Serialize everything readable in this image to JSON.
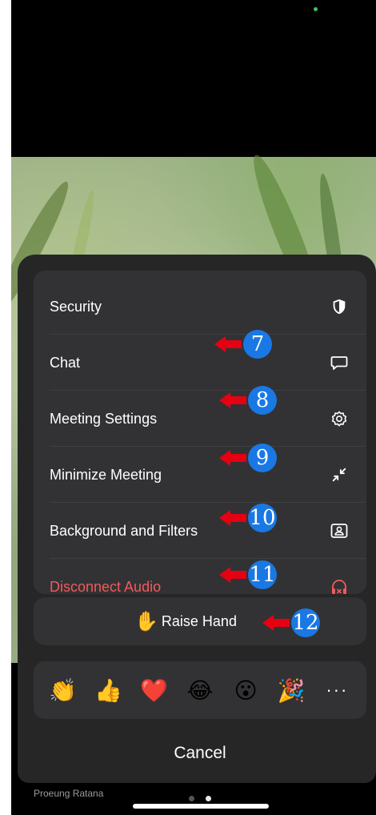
{
  "menu": {
    "items": [
      {
        "label": "Security",
        "icon": "shield-icon"
      },
      {
        "label": "Chat",
        "icon": "chat-bubble-icon"
      },
      {
        "label": "Meeting Settings",
        "icon": "gear-icon"
      },
      {
        "label": "Minimize Meeting",
        "icon": "minimize-arrows-icon"
      },
      {
        "label": "Background and Filters",
        "icon": "person-frame-icon"
      },
      {
        "label": "Disconnect Audio",
        "icon": "headphones-x-icon"
      }
    ],
    "danger_color": "#f25a5a"
  },
  "annotations": [
    "7",
    "8",
    "9",
    "10",
    "11",
    "12"
  ],
  "annotation_colors": {
    "arrow": "#e60012",
    "badge": "#1a78e4"
  },
  "raise_hand": {
    "label": "Raise Hand",
    "emoji": "✋"
  },
  "reactions": [
    "👏",
    "👍",
    "❤️",
    "😂",
    "😮",
    "🎉"
  ],
  "more_label": "···",
  "cancel_label": "Cancel",
  "participant_name": "Proeung Ratana"
}
